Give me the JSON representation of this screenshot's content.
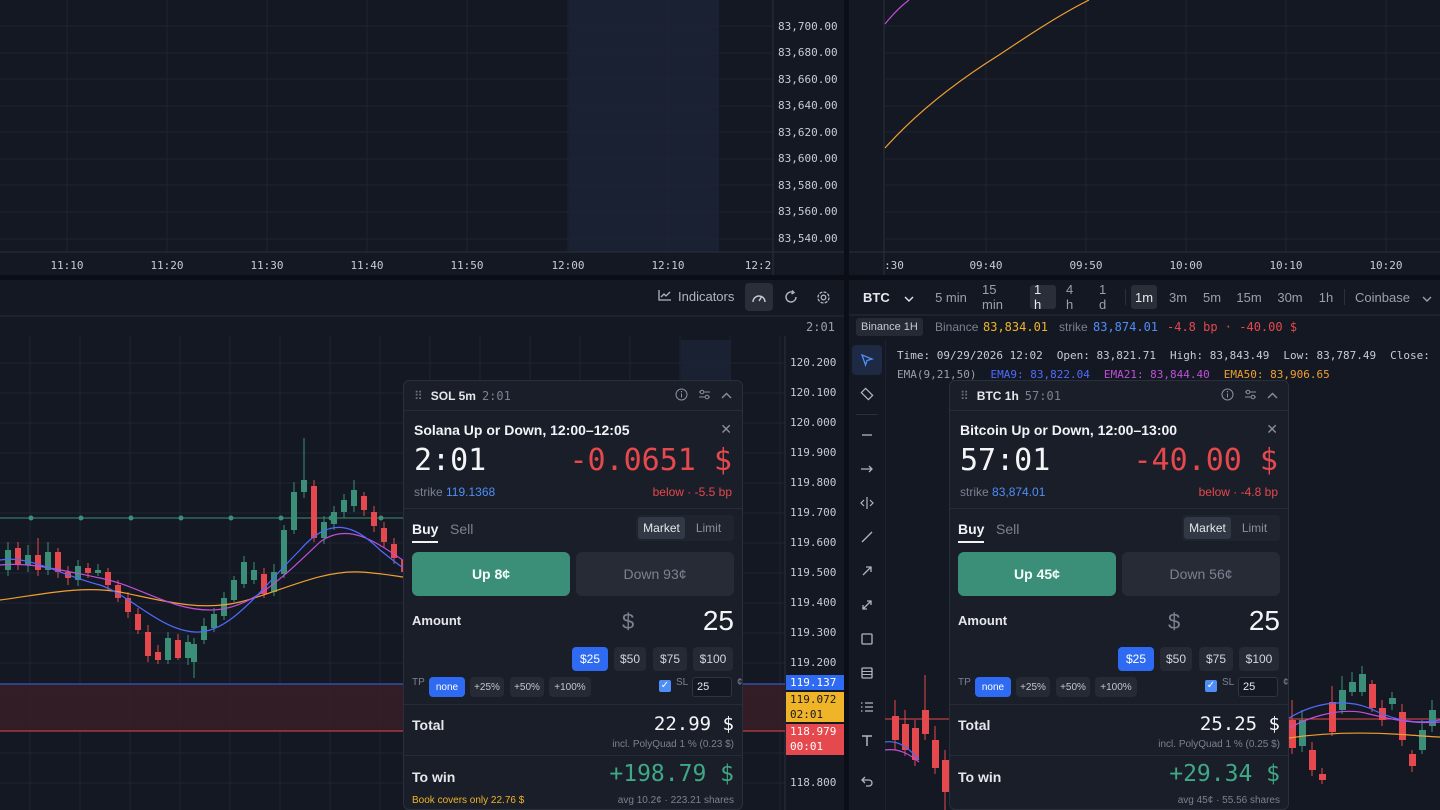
{
  "top_left": {
    "y_ticks": [
      "83,700.00",
      "83,680.00",
      "83,660.00",
      "83,640.00",
      "83,620.00",
      "83,600.00",
      "83,580.00",
      "83,560.00",
      "83,540.00"
    ],
    "x_ticks": [
      "11:10",
      "11:20",
      "11:30",
      "11:40",
      "11:50",
      "12:00",
      "12:10",
      "12:2"
    ]
  },
  "top_right": {
    "x_ticks": [
      ":30",
      "09:40",
      "09:50",
      "10:00",
      "10:10",
      "10:20"
    ]
  },
  "sol_chart": {
    "toolbar": {
      "indicators_label": "Indicators"
    },
    "countdown": "2:01",
    "y_ticks": [
      "120.200",
      "120.100",
      "120.000",
      "119.900",
      "119.800",
      "119.700",
      "119.600",
      "119.500",
      "119.400",
      "119.300",
      "119.200",
      "118.800"
    ],
    "price_tags": {
      "current": "119.137",
      "orange_price": "119.072",
      "orange_time": "02:01",
      "red_price": "118.979",
      "red_time": "00:01"
    }
  },
  "btc_chart": {
    "symbol": "BTC",
    "timeframes": [
      "5 min",
      "15 min",
      "1 h",
      "4 h",
      "1 d"
    ],
    "active_timeframe": "1 h",
    "intervals": [
      "1m",
      "3m",
      "5m",
      "15m",
      "30m",
      "1h"
    ],
    "active_interval": "1m",
    "exchange": "Coinbase",
    "info_bar": {
      "badge": "Binance 1H",
      "source": "Binance",
      "price": "83,834.01",
      "strike_label": "strike",
      "strike": "83,874.01",
      "delta": "-4.8 bp · -40.00 $"
    },
    "ohlc": {
      "time": "Time: 09/29/2026 12:02",
      "open": "Open: 83,821.71",
      "high": "High: 83,843.49",
      "low": "Low: 83,787.49",
      "close": "Close:"
    },
    "ema": {
      "label": "EMA(9,21,50)",
      "ema9": "EMA9: 83,822.04",
      "ema21": "EMA21: 83,844.40",
      "ema50": "EMA50: 83,906.65"
    }
  },
  "sol_card": {
    "symbol": "SOL 5m",
    "time": "2:01",
    "title": "Solana Up or Down, 12:00–12:05",
    "countdown": "2:01",
    "delta": "-0.0651 $",
    "strike_label": "strike",
    "strike": "119.1368",
    "below": "below · -5.5  bp",
    "buy": "Buy",
    "sell": "Sell",
    "market": "Market",
    "limit": "Limit",
    "up": "Up 8¢",
    "down": "Down 93¢",
    "amount_label": "Amount",
    "currency": "$",
    "amount": "25",
    "chips": [
      "$25",
      "$50",
      "$75",
      "$100"
    ],
    "tp_label": "TP",
    "tp_options": [
      "none",
      "+25%",
      "+50%",
      "+100%"
    ],
    "sl_label": "SL",
    "sl_value": "25",
    "sl_unit": "¢",
    "total_label": "Total",
    "total": "22.99 $",
    "fee": "incl. PolyQuad 1 % (0.23 $)",
    "win_label": "To win",
    "win": "+198.79 $",
    "warning": "Book covers only 22.76 $",
    "avg": "avg 10.2¢ · 223.21 shares"
  },
  "btc_card": {
    "symbol": "BTC 1h",
    "time": "57:01",
    "title": "Bitcoin Up or Down, 12:00–13:00",
    "countdown": "57:01",
    "delta": "-40.00 $",
    "strike_label": "strike",
    "strike": "83,874.01",
    "below": "below · -4.8  bp",
    "buy": "Buy",
    "sell": "Sell",
    "market": "Market",
    "limit": "Limit",
    "up": "Up 45¢",
    "down": "Down 56¢",
    "amount_label": "Amount",
    "currency": "$",
    "amount": "25",
    "chips": [
      "$25",
      "$50",
      "$75",
      "$100"
    ],
    "tp_label": "TP",
    "tp_options": [
      "none",
      "+25%",
      "+50%",
      "+100%"
    ],
    "sl_label": "SL",
    "sl_value": "25",
    "sl_unit": "¢",
    "total_label": "Total",
    "total": "25.25 $",
    "fee": "incl. PolyQuad 1 % (0.25 $)",
    "win_label": "To win",
    "win": "+29.34 $",
    "avg": "avg 45¢ · 55.56 shares"
  },
  "colors": {
    "up": "#3b8f78",
    "down": "#e5484d",
    "accent": "#2f6bf2",
    "ema9": "#4f6bff",
    "ema21": "#c04fd8",
    "ema50": "#f0a030"
  }
}
